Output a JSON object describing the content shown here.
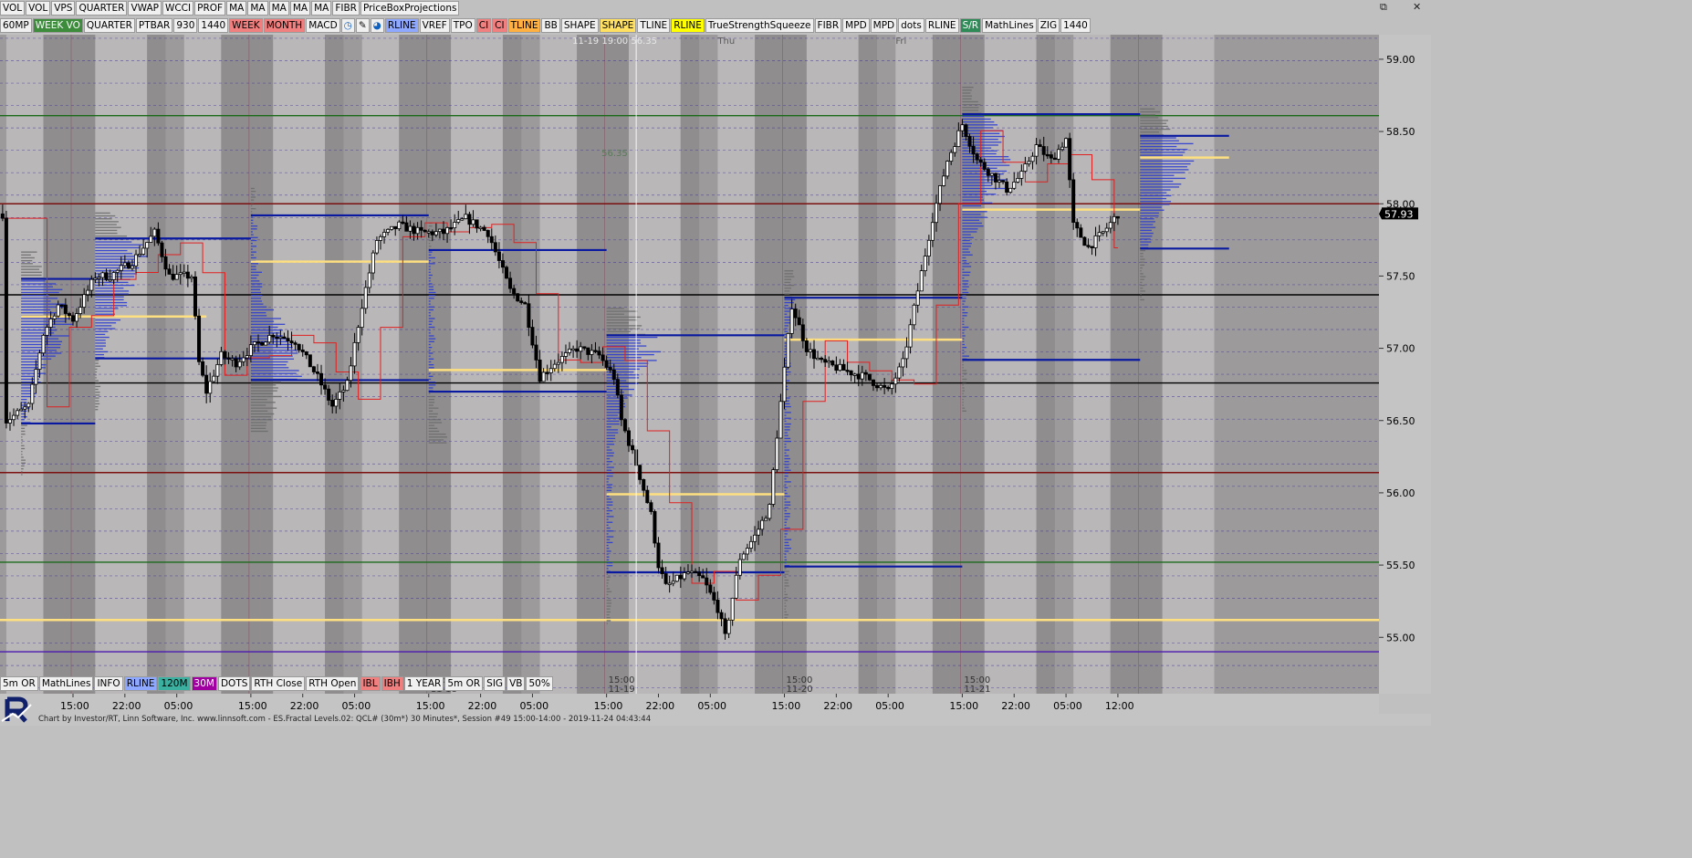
{
  "toolbar_top": [
    "VOL",
    "VOL",
    "VPS",
    "QUARTER",
    "VWAP",
    "WCCI",
    "PROF",
    "MA",
    "MA",
    "MA",
    "MA",
    "MA",
    "FIBR",
    "PriceBoxProjections"
  ],
  "toolbar_second": [
    {
      "label": "60MP",
      "bg": "#f0f0f0"
    },
    {
      "label": "WEEK VO",
      "bg": "#3c8c3c",
      "fg": "#ffffff"
    },
    {
      "label": "QUARTER",
      "bg": "#f0f0f0"
    },
    {
      "label": "PTBAR",
      "bg": "#f0f0f0"
    },
    {
      "label": "930",
      "bg": "#f0f0f0"
    },
    {
      "label": "1440",
      "bg": "#f0f0f0"
    },
    {
      "label": "WEEK",
      "bg": "#f08080"
    },
    {
      "label": "MONTH",
      "bg": "#f08080"
    },
    {
      "label": "MACD",
      "bg": "#f0f0f0"
    },
    {
      "label": "◷",
      "bg": "#f0f0f0",
      "fg": "#1060c0"
    },
    {
      "label": "✎",
      "bg": "#f0f0f0"
    },
    {
      "label": "◕",
      "bg": "#f0f0f0",
      "fg": "#1060c0"
    },
    {
      "label": "RLINE",
      "bg": "#8fa8ff"
    },
    {
      "label": "VREF",
      "bg": "#f0f0f0"
    },
    {
      "label": "TPO",
      "bg": "#f0f0f0"
    },
    {
      "label": "CI",
      "bg": "#f08080"
    },
    {
      "label": "CI",
      "bg": "#f08080"
    },
    {
      "label": "TLINE",
      "bg": "#ffb040"
    },
    {
      "label": "BB",
      "bg": "#f0f0f0"
    },
    {
      "label": "SHAPE",
      "bg": "#f0f0f0"
    },
    {
      "label": "SHAPE",
      "bg": "#ffe060"
    },
    {
      "label": "TLINE",
      "bg": "#f0f0f0"
    },
    {
      "label": "RLINE",
      "bg": "#ffff00"
    },
    {
      "label": "TrueStrengthSqueeze",
      "bg": "#f0f0f0"
    },
    {
      "label": "FIBR",
      "bg": "#f0f0f0"
    },
    {
      "label": "MPD",
      "bg": "#f0f0f0"
    },
    {
      "label": "MPD",
      "bg": "#f0f0f0"
    },
    {
      "label": "dots",
      "bg": "#f0f0f0"
    },
    {
      "label": "RLINE",
      "bg": "#f0f0f0"
    },
    {
      "label": "S/R",
      "bg": "#2e8b57",
      "fg": "#ffffff"
    },
    {
      "label": "MathLines",
      "bg": "#f0f0f0"
    },
    {
      "label": "ZIG",
      "bg": "#f0f0f0"
    },
    {
      "label": "1440",
      "bg": "#f0f0f0"
    }
  ],
  "toolbar_bottom": [
    {
      "label": "5m OR",
      "bg": "#f0f0f0"
    },
    {
      "label": "MathLines",
      "bg": "#f0f0f0"
    },
    {
      "label": "INFO",
      "bg": "#f0f0f0"
    },
    {
      "label": "RLINE",
      "bg": "#8fa8ff"
    },
    {
      "label": "120M",
      "bg": "#3cb0a0"
    },
    {
      "label": "30M",
      "bg": "#a000a0",
      "fg": "#ffffff"
    },
    {
      "label": "DOTS",
      "bg": "#f0f0f0"
    },
    {
      "label": "RTH Close",
      "bg": "#f0f0f0"
    },
    {
      "label": "RTH Open",
      "bg": "#f0f0f0"
    },
    {
      "label": "IBL",
      "bg": "#f08080"
    },
    {
      "label": "IBH",
      "bg": "#f08080"
    },
    {
      "label": "1 YEAR",
      "bg": "#f0f0f0"
    },
    {
      "label": "5m OR",
      "bg": "#f0f0f0"
    },
    {
      "label": "SIG",
      "bg": "#f0f0f0"
    },
    {
      "label": "VB",
      "bg": "#f0f0f0"
    },
    {
      "label": "50%",
      "bg": "#f0f0f0"
    }
  ],
  "window_controls": {
    "restore_icon": "⧉",
    "close_icon": "✕"
  },
  "status_text": "Chart by Investor/RT, Linn Software, Inc. www.linnsoft.com - ES.Fractal Levels.02: QCL# (30m*) 30 Minutes*, Session #49 15:00-14:00 - 2019-11-24 04:43:44",
  "crosshair_label": "11-19 19:00  56.35",
  "crosshair_price_label": "56.35",
  "last_price": "57.93",
  "day_labels": [
    {
      "text": "Thu",
      "bar": 174
    },
    {
      "text": "Fri",
      "bar": 222
    }
  ],
  "session_labels": [
    {
      "time": "15:00",
      "date": "11-18",
      "bar": 96
    },
    {
      "time": "15:00",
      "date": "11-19",
      "bar": 144
    },
    {
      "time": "15:00",
      "date": "11-20",
      "bar": 192
    },
    {
      "time": "15:00",
      "date": "11-21",
      "bar": 240
    }
  ],
  "colors": {
    "background": "#9c9a9b",
    "band_light": "#b9b7b8",
    "band_dark": "#8f8d8e",
    "up_candle": "#ffffff",
    "down_candle": "#000000",
    "profile": "#2b3cd0",
    "profile_gray": "#6d6d6d",
    "val_vah": "#0a1aa0",
    "poc": "#ffe080",
    "level_red": "#7a1010",
    "level_green": "#1a6a1a",
    "level_purple": "#4a1ab0"
  },
  "chart_data": {
    "type": "candlestick",
    "symbol": "QCL#",
    "bar_interval": "30 Minutes",
    "ylim": [
      54.61,
      59.17
    ],
    "price_ticks": [
      "59.00",
      "58.50",
      "58.00",
      "57.50",
      "57.00",
      "56.50",
      "56.00",
      "55.50",
      "55.00"
    ],
    "time_ticks": [
      {
        "label": "15:00",
        "bar": 0
      },
      {
        "label": "22:00",
        "bar": 14
      },
      {
        "label": "05:00",
        "bar": 28
      },
      {
        "label": "15:00",
        "bar": 48
      },
      {
        "label": "22:00",
        "bar": 62
      },
      {
        "label": "05:00",
        "bar": 76
      },
      {
        "label": "15:00",
        "bar": 96
      },
      {
        "label": "22:00",
        "bar": 110
      },
      {
        "label": "05:00",
        "bar": 124
      },
      {
        "label": "15:00",
        "bar": 144
      },
      {
        "label": "22:00",
        "bar": 158
      },
      {
        "label": "05:00",
        "bar": 172
      },
      {
        "label": "15:00",
        "bar": 192
      },
      {
        "label": "22:00",
        "bar": 206
      },
      {
        "label": "05:00",
        "bar": 220
      },
      {
        "label": "15:00",
        "bar": 240
      },
      {
        "label": "22:00",
        "bar": 254
      },
      {
        "label": "05:00",
        "bar": 268
      },
      {
        "label": "12:00",
        "bar": 282
      }
    ],
    "close_path": [
      [
        -18,
        56.5
      ],
      [
        -12,
        56.6
      ],
      [
        -8,
        57.1
      ],
      [
        -4,
        57.3
      ],
      [
        0,
        57.2
      ],
      [
        6,
        57.5
      ],
      [
        10,
        57.5
      ],
      [
        16,
        57.6
      ],
      [
        22,
        57.8
      ],
      [
        26,
        57.5
      ],
      [
        32,
        57.5
      ],
      [
        34,
        56.9
      ],
      [
        36,
        56.7
      ],
      [
        40,
        56.95
      ],
      [
        44,
        56.9
      ],
      [
        48,
        57.0
      ],
      [
        54,
        57.1
      ],
      [
        60,
        57.05
      ],
      [
        66,
        56.8
      ],
      [
        70,
        56.6
      ],
      [
        74,
        56.75
      ],
      [
        78,
        57.3
      ],
      [
        82,
        57.75
      ],
      [
        88,
        57.85
      ],
      [
        94,
        57.8
      ],
      [
        100,
        57.8
      ],
      [
        106,
        57.9
      ],
      [
        112,
        57.8
      ],
      [
        118,
        57.4
      ],
      [
        122,
        57.3
      ],
      [
        126,
        56.8
      ],
      [
        130,
        56.9
      ],
      [
        136,
        57.0
      ],
      [
        142,
        56.95
      ],
      [
        146,
        56.8
      ],
      [
        148,
        56.5
      ],
      [
        152,
        56.2
      ],
      [
        156,
        55.85
      ],
      [
        158,
        55.5
      ],
      [
        160,
        55.35
      ],
      [
        166,
        55.45
      ],
      [
        170,
        55.4
      ],
      [
        174,
        55.2
      ],
      [
        176,
        55.0
      ],
      [
        180,
        55.55
      ],
      [
        184,
        55.7
      ],
      [
        188,
        55.9
      ],
      [
        190,
        56.4
      ],
      [
        194,
        57.3
      ],
      [
        198,
        57.0
      ],
      [
        202,
        56.9
      ],
      [
        208,
        56.85
      ],
      [
        214,
        56.8
      ],
      [
        220,
        56.7
      ],
      [
        224,
        56.9
      ],
      [
        228,
        57.4
      ],
      [
        232,
        57.9
      ],
      [
        236,
        58.3
      ],
      [
        240,
        58.55
      ],
      [
        244,
        58.3
      ],
      [
        248,
        58.2
      ],
      [
        252,
        58.1
      ],
      [
        256,
        58.2
      ],
      [
        260,
        58.4
      ],
      [
        264,
        58.3
      ],
      [
        268,
        58.45
      ],
      [
        270,
        57.85
      ],
      [
        274,
        57.7
      ],
      [
        278,
        57.8
      ],
      [
        282,
        57.93
      ]
    ],
    "value_areas": [
      {
        "bar_start": -14,
        "bar_end": 6,
        "val": 56.48,
        "vah": 57.48
      },
      {
        "bar_start": 6,
        "bar_end": 48,
        "val": 56.93,
        "vah": 57.76
      },
      {
        "bar_start": 48,
        "bar_end": 96,
        "val": 56.78,
        "vah": 57.92
      },
      {
        "bar_start": 96,
        "bar_end": 144,
        "val": 56.7,
        "vah": 57.68
      },
      {
        "bar_start": 144,
        "bar_end": 192,
        "val": 55.45,
        "vah": 57.09
      },
      {
        "bar_start": 192,
        "bar_end": 240,
        "val": 55.49,
        "vah": 57.35
      },
      {
        "bar_start": 240,
        "bar_end": 288,
        "val": 56.92,
        "vah": 58.62
      },
      {
        "bar_start": 288,
        "bar_end": 312,
        "val": 57.69,
        "vah": 58.47
      }
    ],
    "pocs": [
      {
        "bar_start": -14,
        "bar_end": 36,
        "price": 57.22
      },
      {
        "bar_start": 48,
        "bar_end": 96,
        "price": 57.6
      },
      {
        "bar_start": 96,
        "bar_end": 144,
        "price": 56.85
      },
      {
        "bar_start": 144,
        "bar_end": 192,
        "price": 55.99
      },
      {
        "bar_start": 192,
        "bar_end": 240,
        "price": 57.06
      },
      {
        "bar_start": 240,
        "bar_end": 288,
        "price": 57.96
      },
      {
        "bar_start": 288,
        "bar_end": 312,
        "price": 58.32
      }
    ],
    "levels": [
      {
        "price": 58.61,
        "color": "level_green"
      },
      {
        "price": 58.0,
        "color": "level_red"
      },
      {
        "price": 57.37,
        "color": "down_candle"
      },
      {
        "price": 56.76,
        "color": "down_candle"
      },
      {
        "price": 56.14,
        "color": "level_red"
      },
      {
        "price": 55.52,
        "color": "level_green"
      },
      {
        "price": 55.12,
        "color": "poc"
      },
      {
        "price": 54.9,
        "color": "level_purple"
      }
    ]
  }
}
